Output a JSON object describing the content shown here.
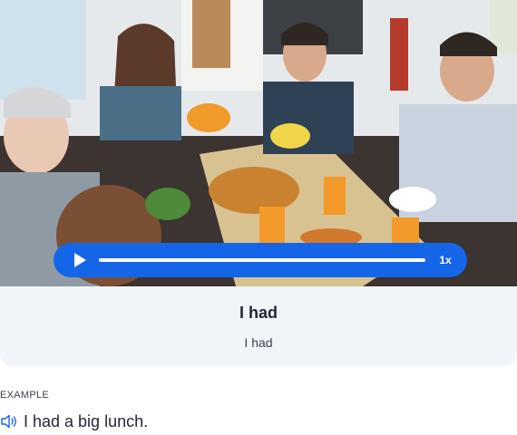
{
  "player": {
    "speed_label": "1x",
    "progress": 0
  },
  "flashcard": {
    "word": "I had",
    "translation": "I had"
  },
  "example": {
    "label": "EXAMPLE",
    "sentence": "I had a big lunch."
  },
  "colors": {
    "accent": "#1565e8",
    "card_bg": "#f1f4f9",
    "text": "#1f2533"
  },
  "icons": {
    "play": "play-icon",
    "speaker": "speaker-icon"
  }
}
